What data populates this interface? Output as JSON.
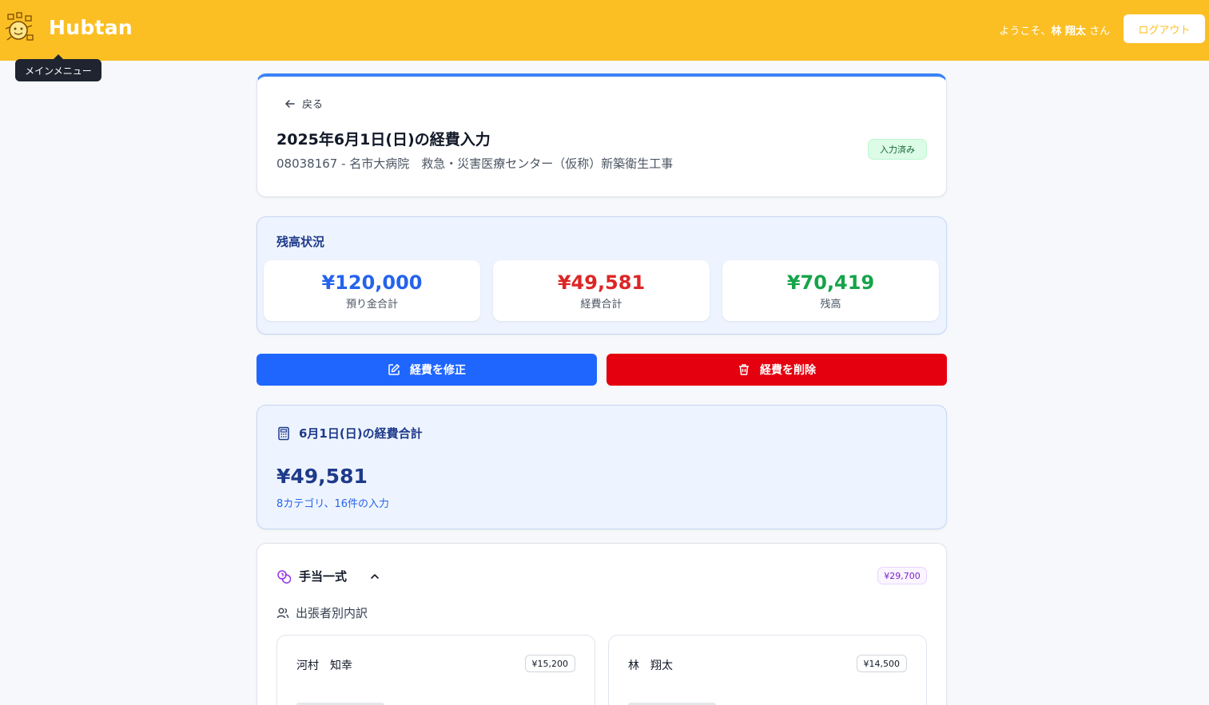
{
  "header": {
    "app_name": "Hubtan",
    "welcome_prefix": "ようこそ、",
    "user_name": "林 翔太",
    "welcome_suffix": " さん",
    "logout_label": "ログアウト",
    "tooltip": "メインメニュー",
    "brand_color": "#fbbf24"
  },
  "title_card": {
    "back_label": "戻る",
    "title": "2025年6月1日(日)の経費入力",
    "subtitle": "08038167 - 名市大病院　救急・災害医療センター（仮称）新築衛生工事",
    "status": "入力済み"
  },
  "balance": {
    "heading": "残高状況",
    "items": [
      {
        "amount": "¥120,000",
        "label": "預り金合計",
        "color": "#2563eb"
      },
      {
        "amount": "¥49,581",
        "label": "経費合計",
        "color": "#dc2626"
      },
      {
        "amount": "¥70,419",
        "label": "残高",
        "color": "#16a34a"
      }
    ]
  },
  "actions": {
    "edit_label": "経費を修正",
    "delete_label": "経費を削除"
  },
  "daily": {
    "heading": "6月1日(日)の経費合計",
    "amount": "¥49,581",
    "summary": "8カテゴリ、16件の入力"
  },
  "allowance": {
    "title": "手当一式",
    "total": "¥29,700",
    "breakdown_heading": "出張者別内訳",
    "people": [
      {
        "name": "河村　知幸",
        "amount": "¥15,200"
      },
      {
        "name": "林　翔太",
        "amount": "¥14,500"
      }
    ]
  }
}
